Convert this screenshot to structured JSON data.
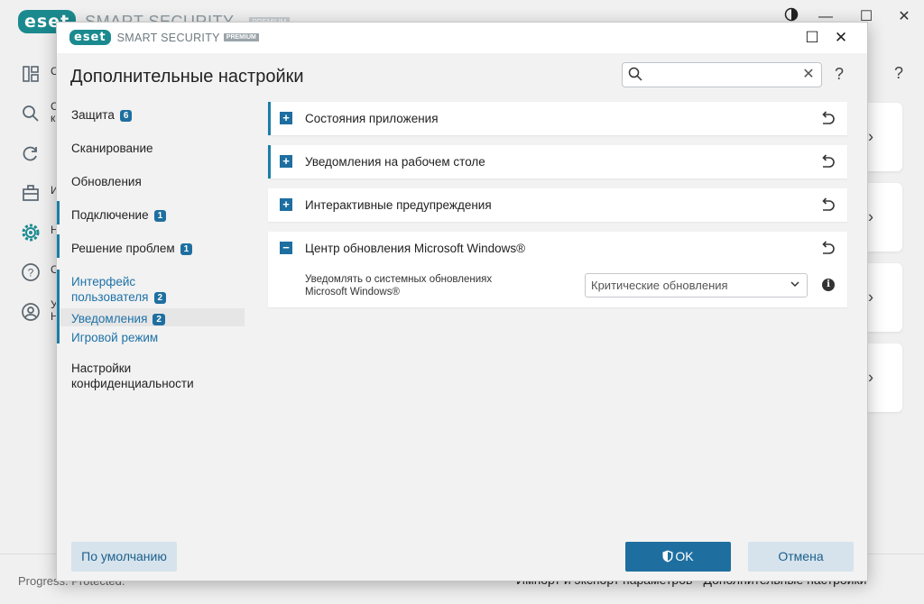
{
  "main_window": {
    "logo": "eset",
    "product": "SMART SECURITY",
    "edition": "PREMIUM",
    "nav": [
      {
        "icon": "dashboard-icon",
        "label": "С"
      },
      {
        "icon": "search-icon",
        "label": "С к"
      },
      {
        "icon": "refresh-icon",
        "label": ""
      },
      {
        "icon": "briefcase-icon",
        "label": "И"
      },
      {
        "icon": "gear-icon",
        "label": "Н"
      },
      {
        "icon": "help-icon",
        "label": "С"
      },
      {
        "icon": "account-icon",
        "label": "У Н"
      }
    ],
    "footer_left": "Progress. Protected.",
    "footer_import": "Импорт и экспорт параметров",
    "footer_advanced": "Дополнительные настройки"
  },
  "dialog": {
    "logo": "eset",
    "product": "SMART SECURITY",
    "edition": "PREMIUM",
    "title": "Дополнительные настройки",
    "search": {
      "value": "",
      "placeholder": ""
    },
    "help": "?",
    "sidebar": [
      {
        "label": "Защита",
        "badge": "6"
      },
      {
        "label": "Сканирование",
        "badge": ""
      },
      {
        "label": "Обновления",
        "badge": ""
      },
      {
        "label": "Подключение",
        "badge": "1"
      },
      {
        "label": "Решение проблем",
        "badge": "1"
      },
      {
        "label": "Интерфейс пользователя",
        "line1": "Интерфейс",
        "line2": "пользователя",
        "badge": "2"
      },
      {
        "label": "Уведомления",
        "badge": "2"
      },
      {
        "label": "Игровой режим",
        "badge": ""
      },
      {
        "label": "Настройки конфиденциальности",
        "line1": "Настройки",
        "line2": "конфиденциальности",
        "badge": ""
      }
    ],
    "panels": [
      {
        "title": "Состояния приложения",
        "expanded": false
      },
      {
        "title": "Уведомления на рабочем столе",
        "expanded": false
      },
      {
        "title": "Интерактивные предупреждения",
        "expanded": false
      },
      {
        "title": "Центр обновления Microsoft Windows®",
        "expanded": true
      }
    ],
    "setting": {
      "label_line1": "Уведомлять о системных обновлениях",
      "label_line2": "Microsoft Windows®",
      "value": "Критические обновления"
    },
    "buttons": {
      "default": "По умолчанию",
      "ok": "OK",
      "cancel": "Отмена"
    }
  },
  "colors": {
    "accent": "#1b7ea5",
    "brand": "#1b8a8f",
    "primary_button": "#1e6fa0",
    "secondary_button": "#d6e3ec"
  }
}
